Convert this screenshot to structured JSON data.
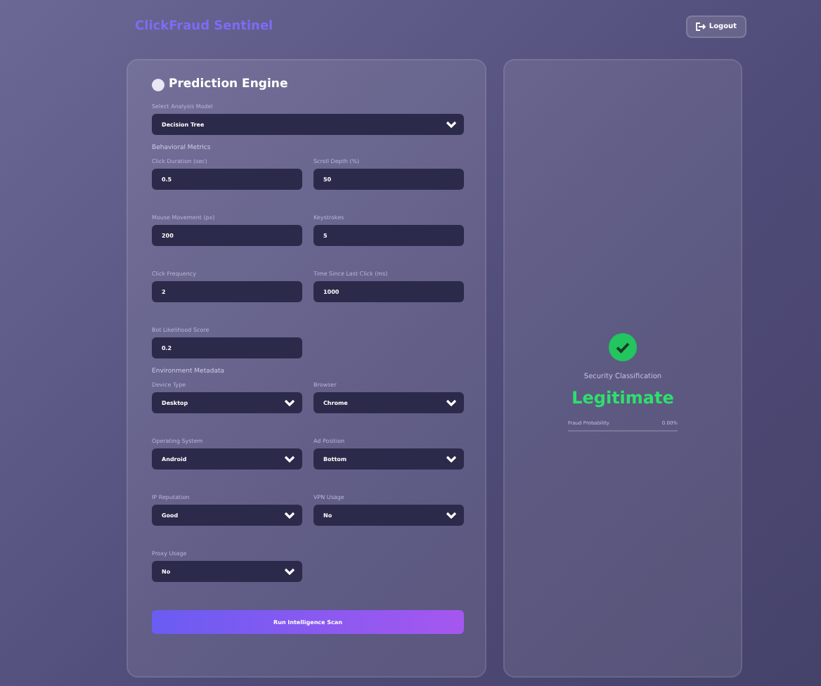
{
  "header": {
    "brand": "ClickFraud Sentinel",
    "logout": "Logout"
  },
  "engine": {
    "title": "Prediction Engine",
    "model_label": "Select Analysis Model",
    "model_value": "Decision Tree",
    "sections": [
      {
        "title": "Behavioral Metrics",
        "fields": [
          {
            "kind": "input",
            "label": "Click Duration (sec)",
            "value": "0.5"
          },
          {
            "kind": "input",
            "label": "Scroll Depth (%)",
            "value": "50"
          },
          {
            "kind": "input",
            "label": "Mouse Movement (px)",
            "value": "200"
          },
          {
            "kind": "input",
            "label": "Keystrokes",
            "value": "5"
          },
          {
            "kind": "input",
            "label": "Click Frequency",
            "value": "2"
          },
          {
            "kind": "input",
            "label": "Time Since Last Click (ms)",
            "value": "1000"
          },
          {
            "kind": "input",
            "label": "Bot Likelihood Score",
            "value": "0.2"
          }
        ]
      },
      {
        "title": "Environment Metadata",
        "fields": [
          {
            "kind": "select",
            "label": "Device Type",
            "value": "Desktop"
          },
          {
            "kind": "select",
            "label": "Browser",
            "value": "Chrome"
          },
          {
            "kind": "select",
            "label": "Operating System",
            "value": "Android"
          },
          {
            "kind": "select",
            "label": "Ad Position",
            "value": "Bottom"
          },
          {
            "kind": "select",
            "label": "IP Reputation",
            "value": "Good"
          },
          {
            "kind": "select",
            "label": "VPN Usage",
            "value": "No"
          },
          {
            "kind": "select",
            "label": "Proxy Usage",
            "value": "No"
          }
        ]
      }
    ],
    "button": "Run Intelligence Scan"
  },
  "result": {
    "caption": "Security Classification",
    "verdict": "Legitimate",
    "metric_label": "Fraud Probability",
    "metric_value": "0.00%"
  }
}
